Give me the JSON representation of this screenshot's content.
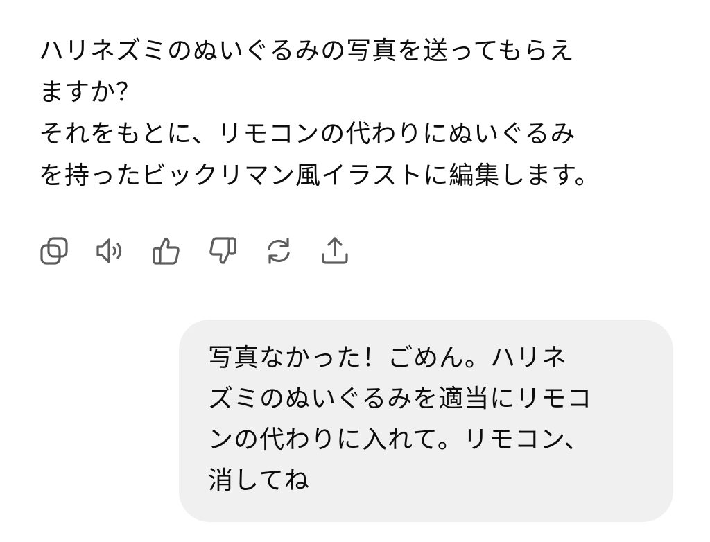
{
  "assistant": {
    "lines": [
      "ハリネズミのぬいぐるみの写真を送ってもらえ",
      "ますか？",
      "それをもとに、リモコンの代わりにぬいぐるみ",
      "を持ったビックリマン風イラストに編集します。"
    ]
  },
  "actions": [
    {
      "icon": "copy-icon"
    },
    {
      "icon": "speaker-icon"
    },
    {
      "icon": "thumbs-up-icon"
    },
    {
      "icon": "thumbs-down-icon"
    },
    {
      "icon": "regenerate-icon"
    },
    {
      "icon": "share-icon"
    }
  ],
  "user": {
    "lines": [
      "写真なかった！ごめん。ハリネ",
      "ズミのぬいぐるみを適当にリモコ",
      "ンの代わりに入れて。リモコン、",
      "消してね"
    ]
  },
  "colors": {
    "text": "#0d0d0d",
    "icon": "#5d5d5d",
    "user_bubble": "#f0f0f0",
    "background": "#ffffff"
  }
}
